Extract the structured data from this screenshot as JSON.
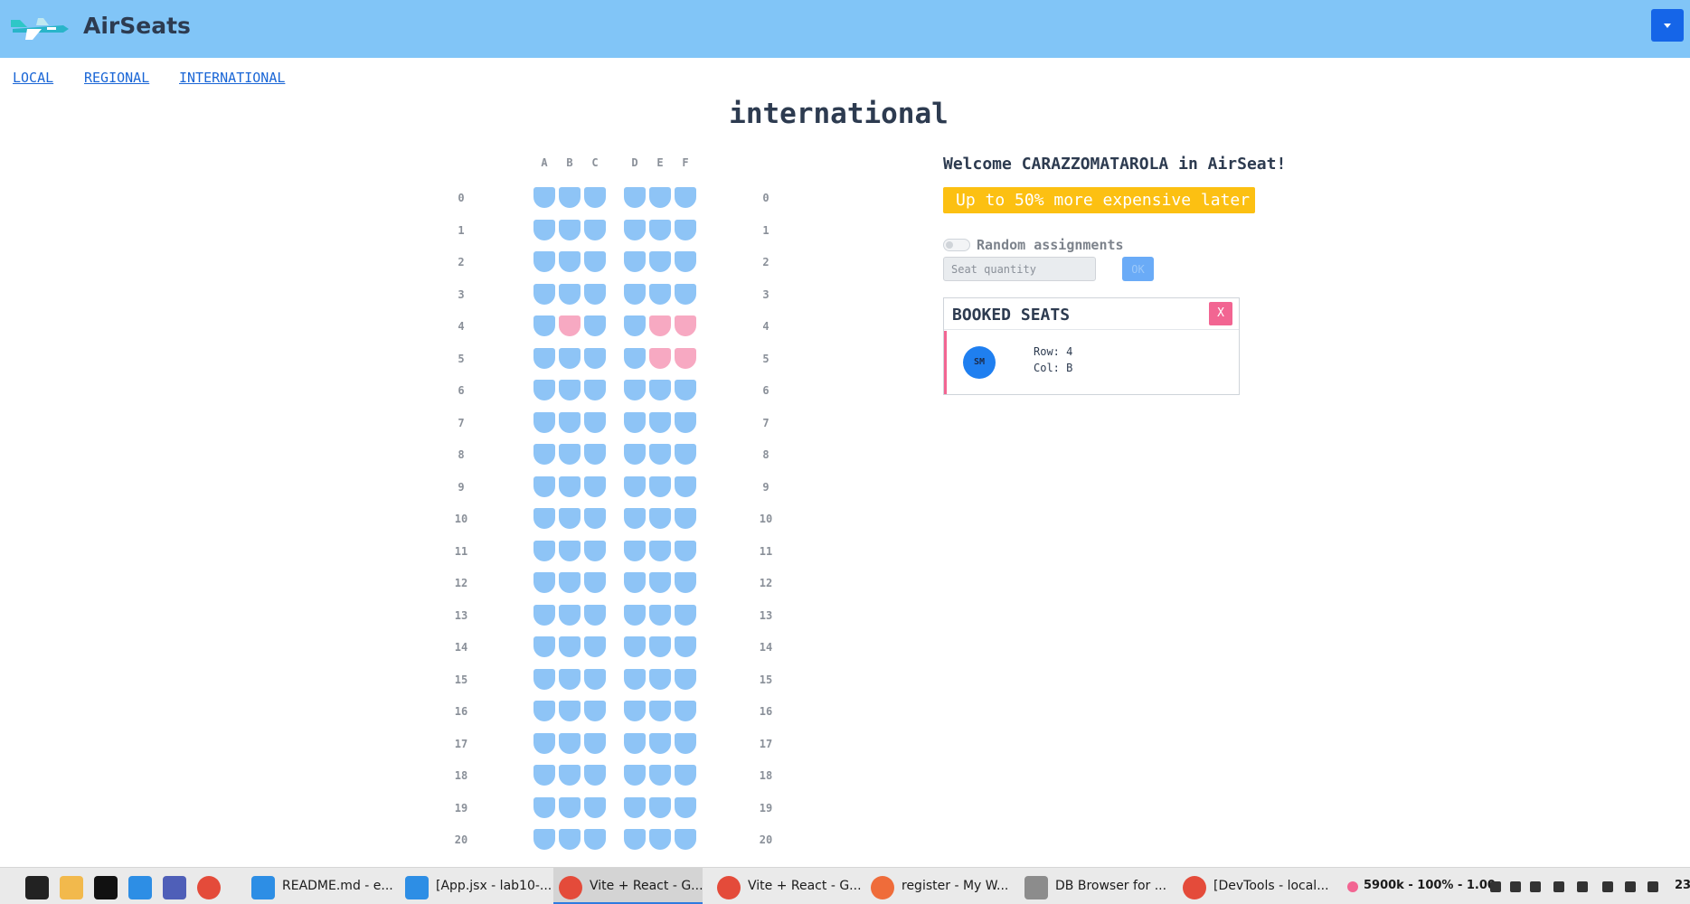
{
  "header": {
    "brand": "AirSeats",
    "logo_icon": "airplane-icon",
    "menu_icon": "caret-down-icon"
  },
  "nav": {
    "links": [
      "LOCAL",
      "REGIONAL",
      "INTERNATIONAL"
    ]
  },
  "page": {
    "title": "international"
  },
  "seatmap": {
    "columns": [
      "A",
      "B",
      "C",
      "D",
      "E",
      "F"
    ],
    "rows": [
      "0",
      "1",
      "2",
      "3",
      "4",
      "5",
      "6",
      "7",
      "8",
      "9",
      "10",
      "11",
      "12",
      "13",
      "14",
      "15",
      "16",
      "17",
      "18",
      "19",
      "20"
    ],
    "booked": [
      {
        "row": "4",
        "col": "B"
      },
      {
        "row": "4",
        "col": "E"
      },
      {
        "row": "4",
        "col": "F"
      },
      {
        "row": "5",
        "col": "E"
      },
      {
        "row": "5",
        "col": "F"
      }
    ],
    "colors": {
      "available": "#8ec4f6",
      "booked": "#f7a9c2"
    }
  },
  "sidebar": {
    "welcome_prefix": "Welcome ",
    "username": "CARAZZOMATAROLA",
    "welcome_suffix": " in AirSeat!",
    "promo": "Up to 50% more expensive later",
    "toggle_label": "Random assignments",
    "qty_placeholder": "Seat quantity",
    "ok_label": "OK"
  },
  "booked_panel": {
    "title": "BOOKED SEATS",
    "close_label": "X",
    "items": [
      {
        "avatar": "SM",
        "row_text": "Row: 4",
        "col_text": "Col: B"
      }
    ]
  },
  "taskbar": {
    "tasks": [
      "README.md - e...",
      "[App.jsx - lab10-...",
      "Vite + React - G...",
      "Vite + React - G...",
      "register - My W...",
      "DB Browser for ...",
      "[DevTools - local..."
    ],
    "tray_text": "5900k - 100% - 1.00",
    "clock": "23:"
  }
}
